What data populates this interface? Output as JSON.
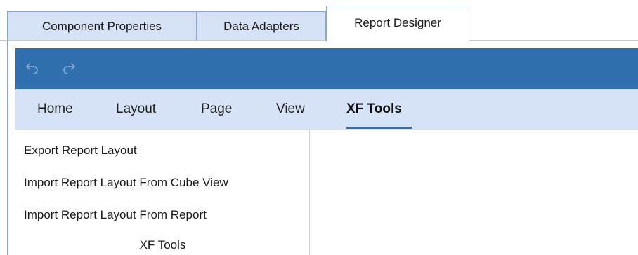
{
  "document_tabs": [
    {
      "label": "Component Properties",
      "active": false
    },
    {
      "label": "Data Adapters",
      "active": false
    },
    {
      "label": "Report Designer",
      "active": true
    }
  ],
  "quick_access": {
    "undo_icon": "undo-icon",
    "redo_icon": "redo-icon",
    "bar_color": "#2f6fad"
  },
  "ribbon": {
    "tabs": [
      {
        "label": "Home"
      },
      {
        "label": "Layout"
      },
      {
        "label": "Page"
      },
      {
        "label": "View"
      },
      {
        "label": "XF Tools"
      }
    ],
    "active_tab": "XF Tools",
    "group": {
      "label": "XF Tools",
      "commands": [
        {
          "label": "Export Report Layout"
        },
        {
          "label": "Import Report Layout From Cube View"
        },
        {
          "label": "Import Report Layout From Report"
        }
      ]
    }
  }
}
